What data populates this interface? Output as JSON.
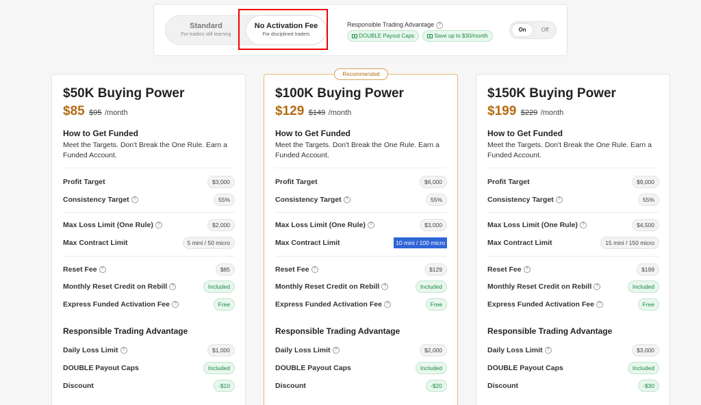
{
  "plan_toggle": {
    "standard": {
      "title": "Standard",
      "subtitle": "For traders still learning"
    },
    "no_activation_fee": {
      "title": "No Activation Fee",
      "subtitle": "For disciplined traders"
    }
  },
  "rta": {
    "label": "Responsible Trading Advantage",
    "badges": [
      "DOUBLE Payout Caps",
      "Save up to $30/month"
    ],
    "on_label": "On",
    "off_label": "Off"
  },
  "recommended_label": "Recommended",
  "help_icon": "?",
  "plans": [
    {
      "title": "$50K Buying Power",
      "price": "$85",
      "old_price": "$95",
      "per": "/month",
      "how_title": "How to Get Funded",
      "how_text": "Meet the Targets. Don't Break the One Rule. Earn a Funded Account.",
      "profit_target_label": "Profit Target",
      "profit_target": "$3,000",
      "consistency_label": "Consistency Target",
      "consistency": "55%",
      "max_loss_label": "Max Loss Limit (One Rule)",
      "max_loss": "$2,000",
      "max_contract_label": "Max Contract Limit",
      "max_contract": "5 mini / 50 micro",
      "reset_fee_label": "Reset Fee",
      "reset_fee": "$85",
      "reset_credit_label": "Monthly Reset Credit on Rebill",
      "reset_credit": "Included",
      "express_label": "Express Funded Activation Fee",
      "express": "Free",
      "rta_title": "Responsible Trading Advantage",
      "daily_loss_label": "Daily Loss Limit",
      "daily_loss": "$1,000",
      "payout_caps_label": "DOUBLE Payout Caps",
      "payout_caps": "Included",
      "discount_label": "Discount",
      "discount": "-$10"
    },
    {
      "title": "$100K Buying Power",
      "price": "$129",
      "old_price": "$149",
      "per": "/month",
      "how_title": "How to Get Funded",
      "how_text": "Meet the Targets. Don't Break the One Rule. Earn a Funded Account.",
      "profit_target_label": "Profit Target",
      "profit_target": "$6,000",
      "consistency_label": "Consistency Target",
      "consistency": "55%",
      "max_loss_label": "Max Loss Limit (One Rule)",
      "max_loss": "$3,000",
      "max_contract_label": "Max Contract Limit",
      "max_contract": "10 mini / 100 micro",
      "reset_fee_label": "Reset Fee",
      "reset_fee": "$129",
      "reset_credit_label": "Monthly Reset Credit on Rebill",
      "reset_credit": "Included",
      "express_label": "Express Funded Activation Fee",
      "express": "Free",
      "rta_title": "Responsible Trading Advantage",
      "daily_loss_label": "Daily Loss Limit",
      "daily_loss": "$2,000",
      "payout_caps_label": "DOUBLE Payout Caps",
      "payout_caps": "Included",
      "discount_label": "Discount",
      "discount": "-$20"
    },
    {
      "title": "$150K Buying Power",
      "price": "$199",
      "old_price": "$229",
      "per": "/month",
      "how_title": "How to Get Funded",
      "how_text": "Meet the Targets. Don't Break the One Rule. Earn a Funded Account.",
      "profit_target_label": "Profit Target",
      "profit_target": "$9,000",
      "consistency_label": "Consistency Target",
      "consistency": "55%",
      "max_loss_label": "Max Loss Limit (One Rule)",
      "max_loss": "$4,500",
      "max_contract_label": "Max Contract Limit",
      "max_contract": "15 mini / 150 micro",
      "reset_fee_label": "Reset Fee",
      "reset_fee": "$199",
      "reset_credit_label": "Monthly Reset Credit on Rebill",
      "reset_credit": "Included",
      "express_label": "Express Funded Activation Fee",
      "express": "Free",
      "rta_title": "Responsible Trading Advantage",
      "daily_loss_label": "Daily Loss Limit",
      "daily_loss": "$3,000",
      "payout_caps_label": "DOUBLE Payout Caps",
      "payout_caps": "Included",
      "discount_label": "Discount",
      "discount": "-$30"
    }
  ]
}
